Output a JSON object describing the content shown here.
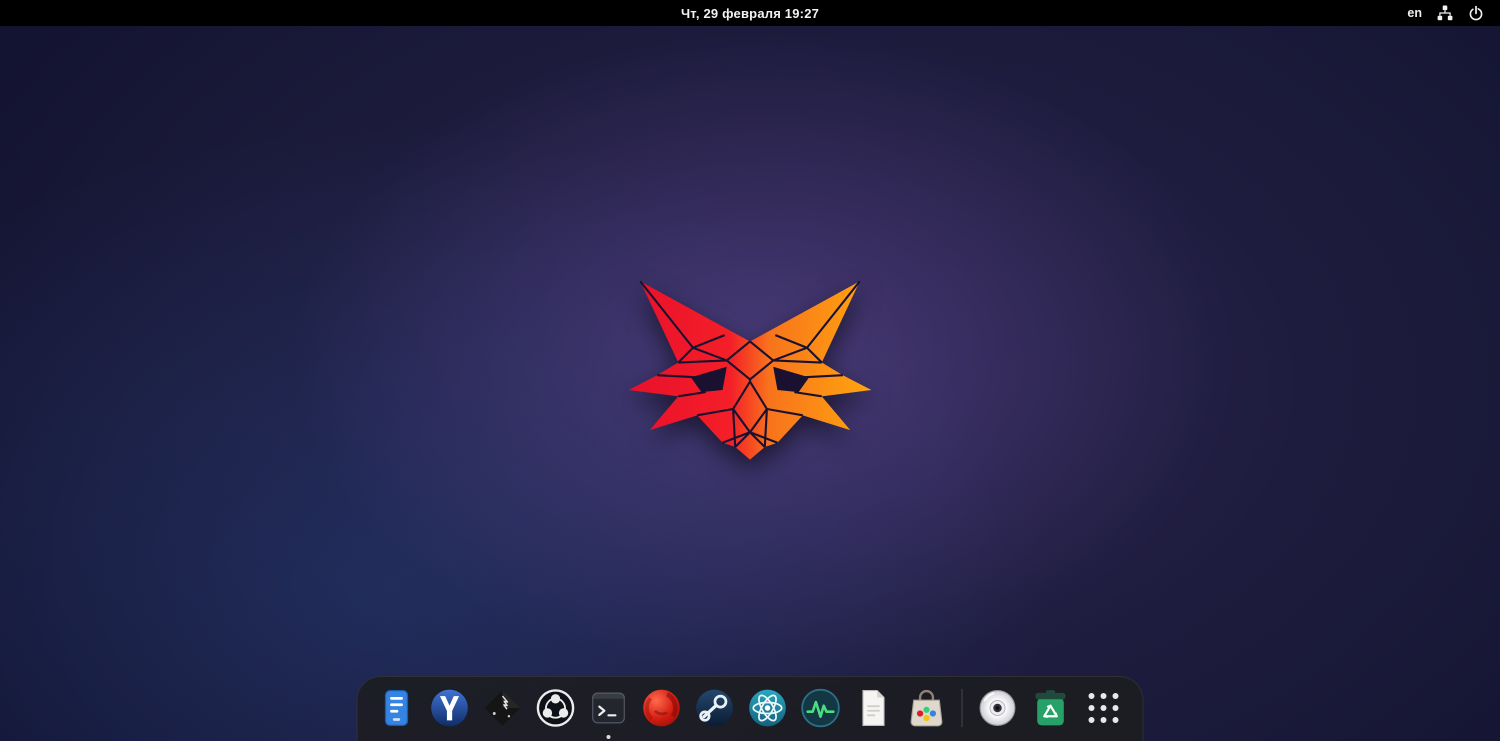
{
  "top_bar": {
    "clock": "Чт, 29 февраля  19:27",
    "keyboard_layout": "en",
    "indicator_icons": [
      "workspaces-tree-icon",
      "power-icon"
    ]
  },
  "wallpaper": {
    "subject": "low-poly fox head logo",
    "colors": {
      "fox_left": "#ee1b2e",
      "fox_right": "#ffa312",
      "background_center": "#2b2552",
      "background_edge": "#0b0d22"
    }
  },
  "dock": {
    "items": [
      {
        "name": "files-notes-app-icon"
      },
      {
        "name": "yandex-browser-icon"
      },
      {
        "name": "inkscape-icon"
      },
      {
        "name": "obs-studio-icon"
      },
      {
        "name": "terminal-icon",
        "running": true
      },
      {
        "name": "red-sphere-app-icon"
      },
      {
        "name": "steam-icon"
      },
      {
        "name": "atom-science-app-icon"
      },
      {
        "name": "system-monitor-icon"
      },
      {
        "name": "document-app-icon"
      },
      {
        "name": "software-store-icon"
      },
      {
        "name": "disc-media-icon"
      },
      {
        "name": "recycle-trash-icon"
      },
      {
        "name": "show-applications-icon"
      }
    ]
  }
}
